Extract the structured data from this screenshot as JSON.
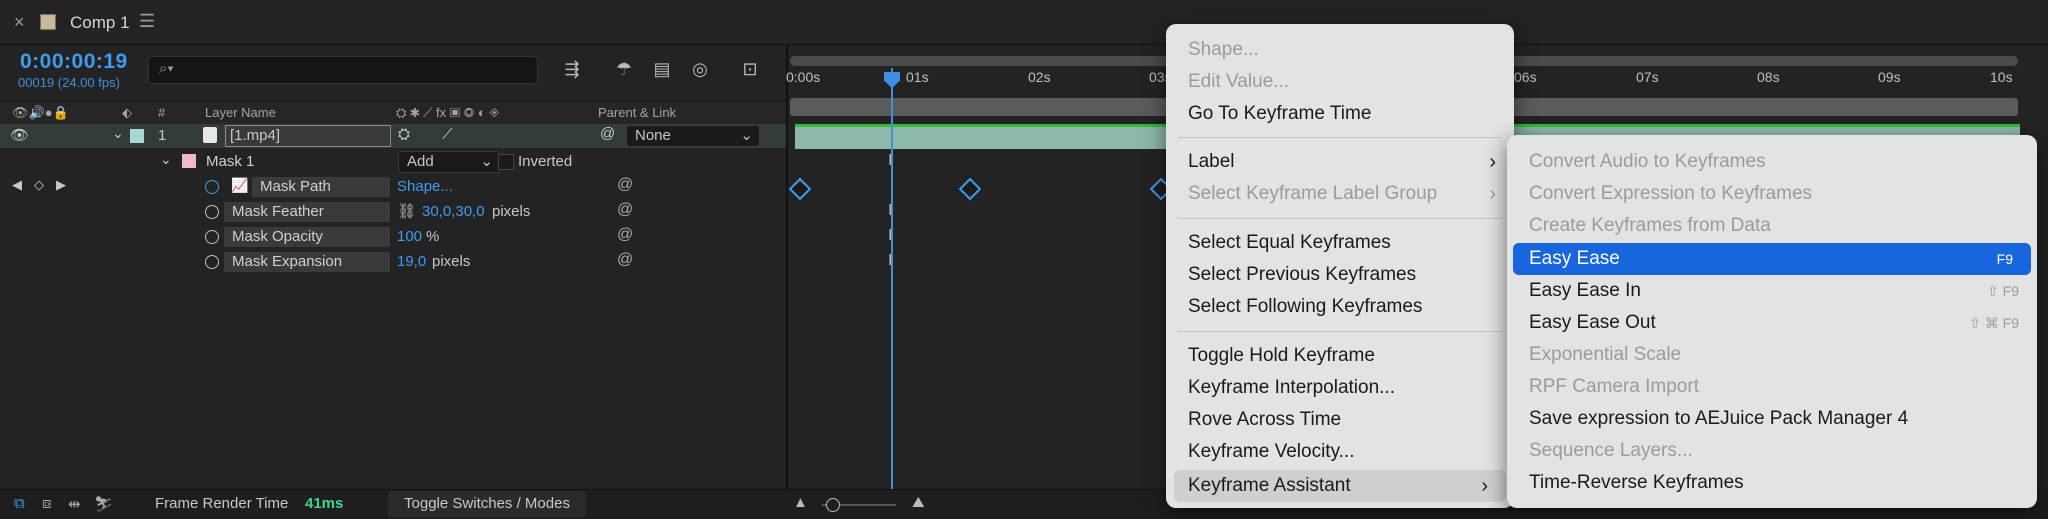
{
  "tab": {
    "close": "×",
    "title": "Comp 1",
    "menu": "☰"
  },
  "timecode": "0:00:00:19",
  "fps": "00019 (24.00 fps)",
  "search": {
    "placeholder": ""
  },
  "header": {
    "num": "#",
    "layer_name": "Layer Name",
    "parent": "Parent & Link"
  },
  "layer": {
    "num": "1",
    "name": "[1.mp4]",
    "parent_value": "None"
  },
  "mask": {
    "name": "Mask 1",
    "mode": "Add",
    "inverted": "Inverted"
  },
  "props": [
    {
      "name": "Mask Path",
      "value": "Shape...",
      "unit": ""
    },
    {
      "name": "Mask Feather",
      "value": "30,0,30,0",
      "unit": "pixels"
    },
    {
      "name": "Mask Opacity",
      "value": "100",
      "unit": "%"
    },
    {
      "name": "Mask Expansion",
      "value": "19,0",
      "unit": "pixels"
    }
  ],
  "bottom": {
    "render_label": "Frame Render Time",
    "render_value": "41ms",
    "toggle": "Toggle Switches / Modes"
  },
  "ruler": [
    "0:00s",
    "01s",
    "02s",
    "03s",
    "06s",
    "07s",
    "08s",
    "09s",
    "10s"
  ],
  "menu1": [
    {
      "label": "Shape...",
      "disabled": true
    },
    {
      "label": "Edit Value...",
      "disabled": true
    },
    {
      "label": "Go To Keyframe Time",
      "disabled": false
    },
    {
      "label": "Label",
      "disabled": false,
      "submenu": true
    },
    {
      "label": "Select Keyframe Label Group",
      "disabled": true,
      "submenu": true
    },
    {
      "label": "Select Equal Keyframes",
      "disabled": false
    },
    {
      "label": "Select Previous Keyframes",
      "disabled": false
    },
    {
      "label": "Select Following Keyframes",
      "disabled": false
    },
    {
      "label": "Toggle Hold Keyframe",
      "disabled": false
    },
    {
      "label": "Keyframe Interpolation...",
      "disabled": false
    },
    {
      "label": "Rove Across Time",
      "disabled": false
    },
    {
      "label": "Keyframe Velocity...",
      "disabled": false
    },
    {
      "label": "Keyframe Assistant",
      "disabled": false,
      "submenu": true,
      "highlighted": true
    }
  ],
  "menu2": [
    {
      "label": "Convert Audio to Keyframes",
      "disabled": true
    },
    {
      "label": "Convert Expression to Keyframes",
      "disabled": true
    },
    {
      "label": "Create Keyframes from Data",
      "disabled": true
    },
    {
      "label": "Easy Ease",
      "shortcut": "F9",
      "selected": true
    },
    {
      "label": "Easy Ease In",
      "shortcut": "⇧ F9"
    },
    {
      "label": "Easy Ease Out",
      "shortcut": "⇧ ⌘ F9"
    },
    {
      "label": "Exponential Scale",
      "disabled": true
    },
    {
      "label": "RPF Camera Import",
      "disabled": true
    },
    {
      "label": "Save expression to AEJuice Pack Manager 4"
    },
    {
      "label": "Sequence Layers...",
      "disabled": true
    },
    {
      "label": "Time-Reverse Keyframes"
    }
  ],
  "colors": {
    "accent": "#3d9cf0",
    "selection": "#1866dd",
    "layer_bar": "#8fb8ad",
    "layer_label": "#a8d8d4",
    "mask_label": "#f0b8c8",
    "render_value": "#3fd68a"
  }
}
